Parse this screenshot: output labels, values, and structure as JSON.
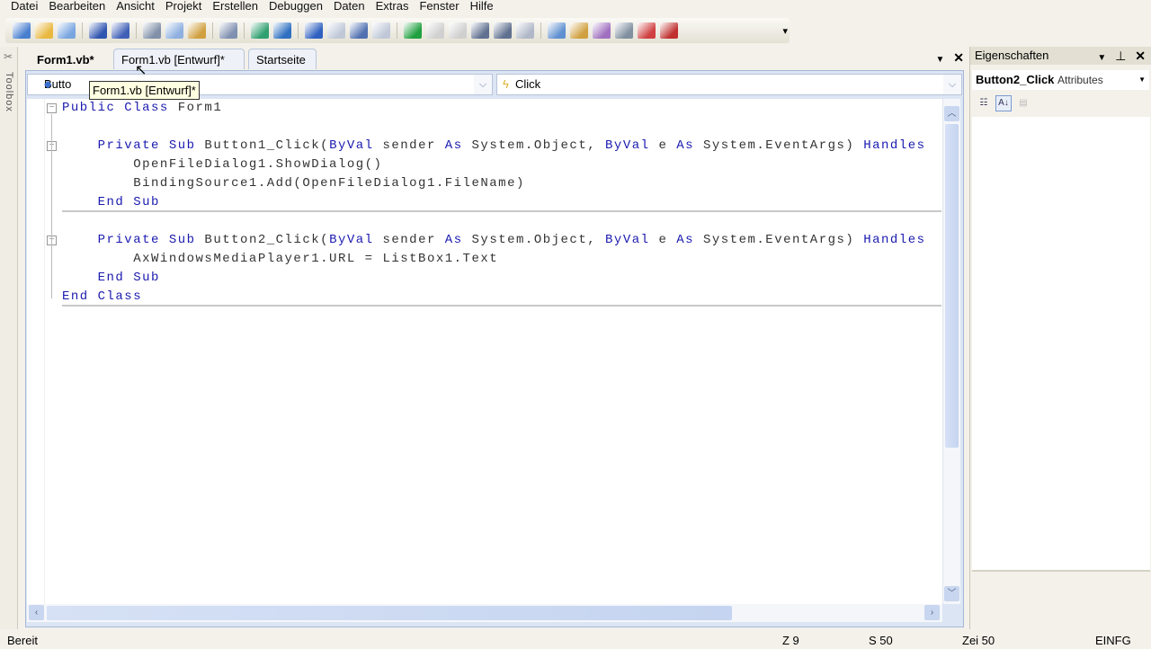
{
  "menu": [
    "Datei",
    "Bearbeiten",
    "Ansicht",
    "Projekt",
    "Erstellen",
    "Debuggen",
    "Daten",
    "Extras",
    "Fenster",
    "Hilfe"
  ],
  "toolbar_icons": [
    {
      "name": "new-project-icon",
      "color": "#4a7fd0"
    },
    {
      "name": "open-file-icon",
      "color": "#e8b840"
    },
    {
      "name": "add-item-icon",
      "color": "#7aa6e0"
    },
    {
      "sep": true
    },
    {
      "name": "save-icon",
      "color": "#3055b0"
    },
    {
      "name": "save-all-icon",
      "color": "#4060b8"
    },
    {
      "sep": true
    },
    {
      "name": "cut-icon",
      "color": "#8090a8"
    },
    {
      "name": "copy-icon",
      "color": "#8fb0e0"
    },
    {
      "name": "paste-icon",
      "color": "#d0a040"
    },
    {
      "sep": true
    },
    {
      "name": "find-icon",
      "color": "#8090b0"
    },
    {
      "sep": true
    },
    {
      "name": "comment-icon",
      "color": "#30a070"
    },
    {
      "name": "uncomment-icon",
      "color": "#3070c0"
    },
    {
      "sep": true
    },
    {
      "name": "undo-icon",
      "color": "#3060c0"
    },
    {
      "name": "redo-icon",
      "color": "#c0c8d8"
    },
    {
      "name": "navigate-icon",
      "color": "#5070b0"
    },
    {
      "name": "navigate-forward-icon",
      "color": "#c0c8d8"
    },
    {
      "sep": true
    },
    {
      "name": "start-debug-icon",
      "color": "#20a040"
    },
    {
      "name": "pause-icon",
      "color": "#d0d0d0"
    },
    {
      "name": "stop-icon",
      "color": "#d0d0d0"
    },
    {
      "name": "step-into-icon",
      "color": "#607090"
    },
    {
      "name": "step-over-icon",
      "color": "#607090"
    },
    {
      "name": "step-out-icon",
      "color": "#b0b8c8"
    },
    {
      "sep": true
    },
    {
      "name": "solution-explorer-icon",
      "color": "#6090d0"
    },
    {
      "name": "properties-window-icon",
      "color": "#d0a040"
    },
    {
      "name": "object-browser-icon",
      "color": "#a070c0"
    },
    {
      "name": "toolbox-icon",
      "color": "#8090a0"
    },
    {
      "name": "error-list-icon",
      "color": "#d04040"
    },
    {
      "name": "start-page-icon",
      "color": "#c03030"
    }
  ],
  "toolbox_label": "Toolbox",
  "tabs": [
    {
      "label": "Form1.vb*",
      "active": true
    },
    {
      "label": "Form1.vb [Entwurf]*",
      "active": false
    },
    {
      "label": "Startseite",
      "active": false
    }
  ],
  "class_combo": "Butto",
  "method_combo": "Click",
  "tooltip": "Form1.vb [Entwurf]*",
  "code_lines": [
    [
      [
        "Public Class",
        "kw"
      ],
      [
        " Form1",
        ""
      ]
    ],
    [],
    [
      [
        "    Private Sub",
        "kw"
      ],
      [
        " Button1_Click(",
        ""
      ],
      [
        "ByVal",
        "kw"
      ],
      [
        " sender ",
        ""
      ],
      [
        "As",
        "kw"
      ],
      [
        " System.Object, ",
        ""
      ],
      [
        "ByVal",
        "kw"
      ],
      [
        " e ",
        ""
      ],
      [
        "As",
        "kw"
      ],
      [
        " System.EventArgs) ",
        ""
      ],
      [
        "Handles",
        "kw"
      ]
    ],
    [
      [
        "        OpenFileDialog1.ShowDialog()",
        ""
      ]
    ],
    [
      [
        "        BindingSource1.Add(OpenFileDialog1.FileName)",
        ""
      ]
    ],
    [
      [
        "    End Sub",
        "kw"
      ]
    ],
    [],
    [
      [
        "    Private Sub",
        "kw"
      ],
      [
        " Button2_Click(",
        ""
      ],
      [
        "ByVal",
        "kw"
      ],
      [
        " sender ",
        ""
      ],
      [
        "As",
        "kw"
      ],
      [
        " System.Object, ",
        ""
      ],
      [
        "ByVal",
        "kw"
      ],
      [
        " e ",
        ""
      ],
      [
        "As",
        "kw"
      ],
      [
        " System.EventArgs) ",
        ""
      ],
      [
        "Handles",
        "kw"
      ]
    ],
    [
      [
        "        AxWindowsMediaPlayer1.URL = ListBox1.Text",
        ""
      ]
    ],
    [
      [
        "    End Sub",
        "kw"
      ]
    ],
    [
      [
        "End Class",
        "kw"
      ]
    ]
  ],
  "properties": {
    "title": "Eigenschaften",
    "object_name": "Button2_Click",
    "object_type": "Attributes"
  },
  "status": {
    "text": "Bereit",
    "line": "Z 9",
    "col": "S 50",
    "char": "Zei 50",
    "mode": "EINFG"
  }
}
